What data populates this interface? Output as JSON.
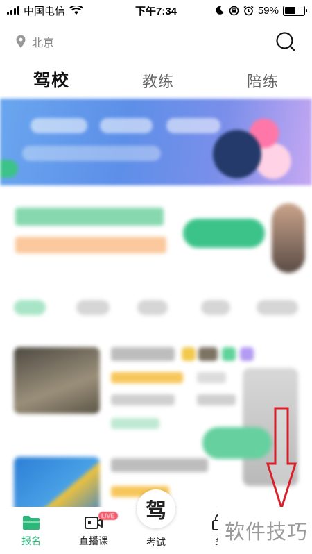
{
  "status_bar": {
    "carrier": "中国电信",
    "time": "下午7:34",
    "battery_percent_text": "59%",
    "battery_level": 0.59
  },
  "location": {
    "city": "北京"
  },
  "tabs": [
    {
      "label": "驾校",
      "active": true
    },
    {
      "label": "教练",
      "active": false
    },
    {
      "label": "陪练",
      "active": false
    }
  ],
  "tab_bar": {
    "items": [
      {
        "label": "报名",
        "active": true
      },
      {
        "label": "直播课",
        "active": false
      },
      {
        "label": "考试",
        "active": false
      },
      {
        "label": "买",
        "active": false
      }
    ],
    "center_glyph": "驾"
  },
  "watermark": "软件技巧",
  "colors": {
    "accent": "#2cb77a",
    "annotation_arrow": "#d9202a",
    "badge": "#f25b6b"
  }
}
